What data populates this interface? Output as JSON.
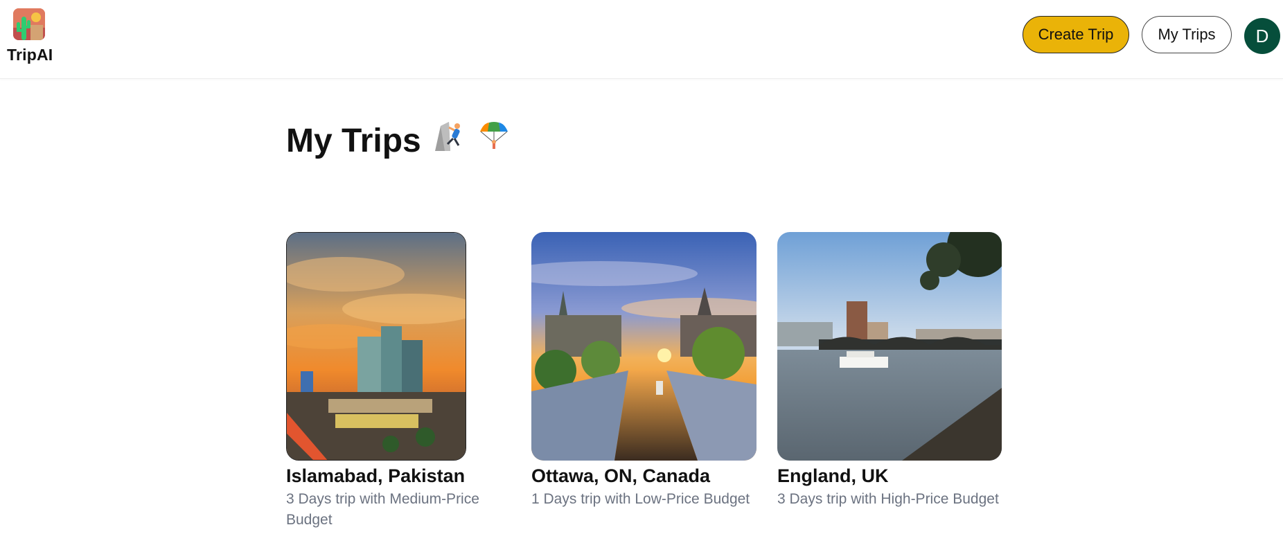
{
  "app": {
    "logo_text": "TripAI"
  },
  "header": {
    "create_trip_label": "Create Trip",
    "my_trips_label": "My Trips",
    "avatar_initial": "D"
  },
  "page": {
    "title": "My Trips",
    "title_icons": [
      "rock-climbing-icon",
      "parachute-icon"
    ]
  },
  "trips": [
    {
      "destination": "Islamabad, Pakistan",
      "summary": "3 Days trip with Medium-Price Budget",
      "image": "islamabad-sunset-photo"
    },
    {
      "destination": "Ottawa, ON, Canada",
      "summary": "1 Days trip with Low-Price Budget",
      "image": "ottawa-canal-photo"
    },
    {
      "destination": "England, UK",
      "summary": "3 Days trip with High-Price Budget",
      "image": "london-thames-photo"
    }
  ],
  "colors": {
    "accent_button": "#eab308",
    "avatar_bg": "#064e3b",
    "muted_text": "#6b7280"
  }
}
